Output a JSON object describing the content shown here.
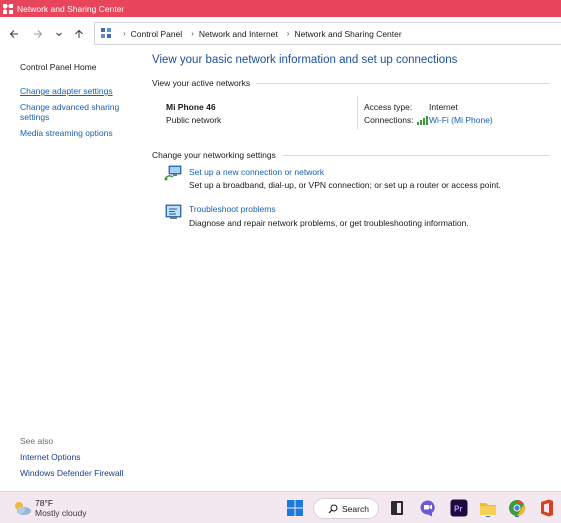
{
  "window": {
    "title": "Network and Sharing Center"
  },
  "address": {
    "crumbs": [
      "Control Panel",
      "Network and Internet",
      "Network and Sharing Center"
    ]
  },
  "sidebar": {
    "items": [
      {
        "label": "Control Panel Home"
      },
      {
        "label": "Change adapter settings"
      },
      {
        "label": "Change advanced sharing settings"
      },
      {
        "label": "Media streaming options"
      }
    ],
    "see_also": {
      "header": "See also",
      "items": [
        {
          "label": "Internet Options"
        },
        {
          "label": "Windows Defender Firewall"
        }
      ]
    }
  },
  "main": {
    "title": "View your basic network information and set up connections",
    "active_networks": {
      "header": "View your active networks",
      "network_name": "Mi Phone 46",
      "network_type": "Public network",
      "access_type_label": "Access type:",
      "access_type_value": "Internet",
      "connections_label": "Connections:",
      "connections_value": "Wi-Fi (Mi Phone)"
    },
    "change_settings": {
      "header": "Change your networking settings",
      "tasks": [
        {
          "title": "Set up a new connection or network",
          "description": "Set up a broadband, dial-up, or VPN connection; or set up a router or access point.",
          "icon": "network-setup-icon"
        },
        {
          "title": "Troubleshoot problems",
          "description": "Diagnose and repair network problems, or get troubleshooting information.",
          "icon": "troubleshoot-icon"
        }
      ]
    }
  },
  "taskbar": {
    "weather": {
      "temp": "78°F",
      "condition": "Mostly cloudy",
      "icon": "partly-cloudy-icon"
    },
    "search_label": "Search",
    "apps": [
      "windows-start-icon",
      "search-icon",
      "task-view-icon",
      "chat-icon",
      "premiere-icon",
      "file-explorer-icon",
      "chrome-icon",
      "office-icon"
    ]
  },
  "colors": {
    "titlebar": "#e8445a",
    "link": "#1a5fb4",
    "title": "#1c4f9c",
    "taskbar": "#f3e8f0"
  }
}
